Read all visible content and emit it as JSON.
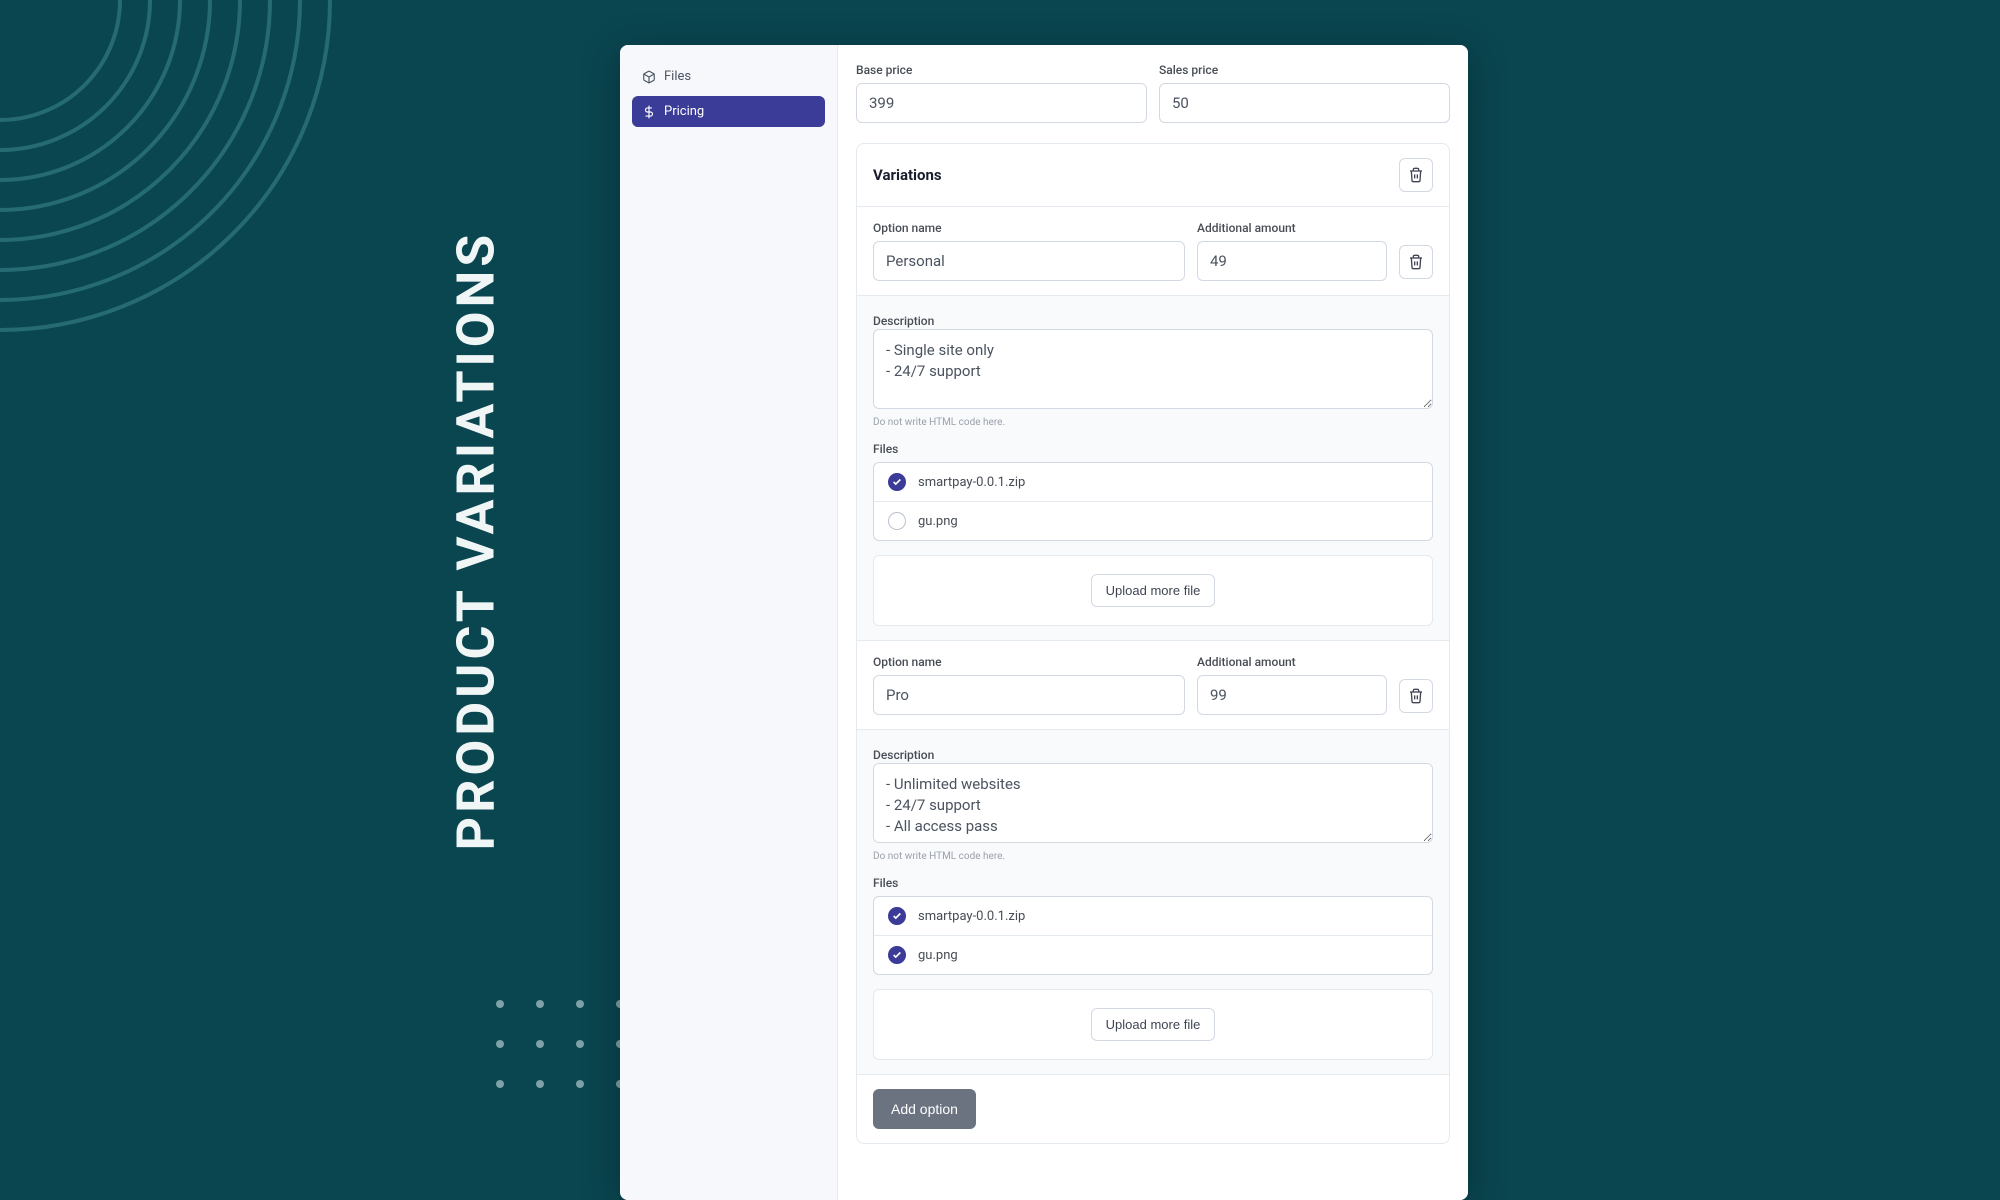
{
  "page_title": "PRODUCT VARIATIONS",
  "sidebar": {
    "items": [
      {
        "label": "Files"
      },
      {
        "label": "Pricing"
      }
    ]
  },
  "pricing": {
    "base_label": "Base price",
    "base_value": "399",
    "sales_label": "Sales price",
    "sales_value": "50"
  },
  "variations": {
    "heading": "Variations",
    "option_name_label": "Option name",
    "additional_amount_label": "Additional amount",
    "description_label": "Description",
    "description_helper": "Do not write HTML code here.",
    "files_label": "Files",
    "upload_label": "Upload more file",
    "add_option_label": "Add option",
    "options": [
      {
        "name": "Personal",
        "amount": "49",
        "description": "- Single site only\n- 24/7 support",
        "files": [
          {
            "name": "smartpay-0.0.1.zip",
            "selected": true
          },
          {
            "name": "gu.png",
            "selected": false
          }
        ]
      },
      {
        "name": "Pro",
        "amount": "99",
        "description": "- Unlimited websites\n- 24/7 support\n- All access pass",
        "files": [
          {
            "name": "smartpay-0.0.1.zip",
            "selected": true
          },
          {
            "name": "gu.png",
            "selected": true
          }
        ]
      }
    ]
  }
}
